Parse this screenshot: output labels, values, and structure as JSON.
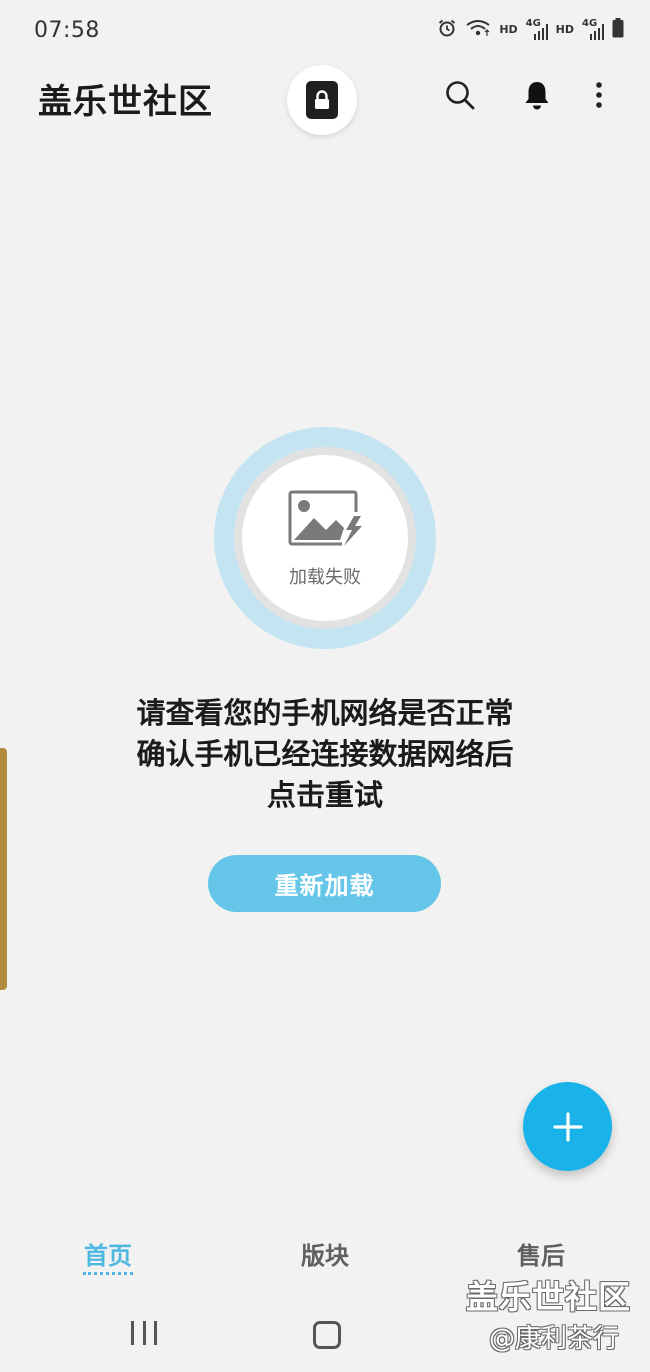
{
  "status_bar": {
    "time": "07:58",
    "hd_1": "HD",
    "net_1": "4G",
    "hd_2": "HD",
    "net_2": "4G",
    "icons": [
      "alarm-icon",
      "wifi-icon",
      "signal-icon",
      "signal-icon",
      "battery-icon"
    ]
  },
  "app_bar": {
    "title": "盖乐世社区",
    "icons": [
      "lock-icon",
      "search-icon",
      "bell-icon",
      "more-vertical-icon"
    ]
  },
  "error": {
    "icon": "broken-image-icon",
    "label": "加载失败",
    "message_lines": [
      "请查看您的手机网络是否正常",
      "确认手机已经连接数据网络后",
      "点击重试"
    ],
    "retry_label": "重新加载"
  },
  "fab": {
    "icon": "plus-icon"
  },
  "bottom_nav": {
    "items": [
      {
        "label": "首页",
        "active": true
      },
      {
        "label": "版块",
        "active": false
      },
      {
        "label": "售后",
        "active": false
      }
    ]
  },
  "watermark": {
    "title": "盖乐世社区",
    "author": "@康利茶行"
  },
  "colors": {
    "background": "#f2f2f2",
    "accent": "#4fb8e0",
    "button": "#66c6e9",
    "fab": "#19b3ea",
    "ring": "#c5e4f1"
  }
}
